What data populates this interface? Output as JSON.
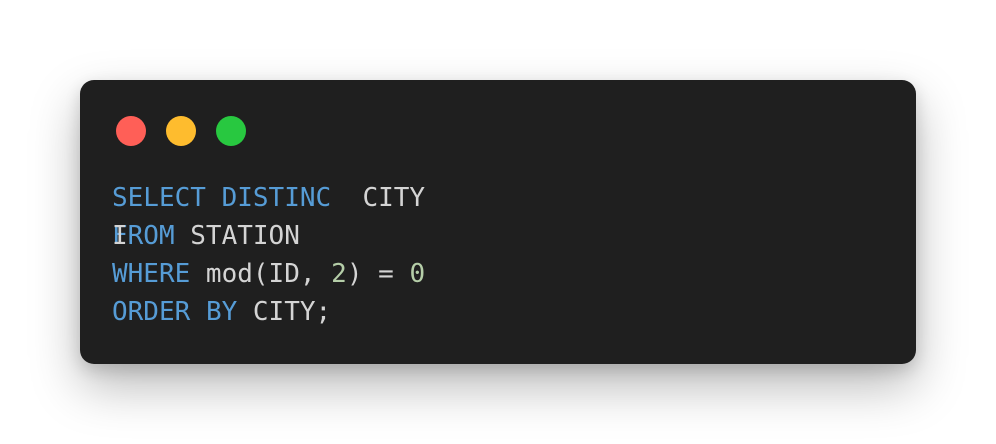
{
  "window": {
    "controls": [
      {
        "name": "close",
        "color": "#ff5f57"
      },
      {
        "name": "minimize",
        "color": "#febc2e"
      },
      {
        "name": "maximize",
        "color": "#28c840"
      }
    ]
  },
  "colors": {
    "background": "#1f1f1f",
    "keyword": "#569cd6",
    "plain": "#d4d4d4",
    "number": "#b5cea8"
  },
  "code": {
    "line1": {
      "kw1": "SELECT",
      "kw2": "DISTINC",
      "rest": "  CITY"
    },
    "line2": {
      "stray": "I",
      "kw": "FROM",
      "rest": " STATION"
    },
    "line3": {
      "kw": "WHERE",
      "a": " mod(ID, ",
      "num1": "2",
      "b": ") = ",
      "num2": "0"
    },
    "line4": {
      "kw1": "ORDER",
      "kw2": "BY",
      "rest": " CITY;"
    }
  }
}
